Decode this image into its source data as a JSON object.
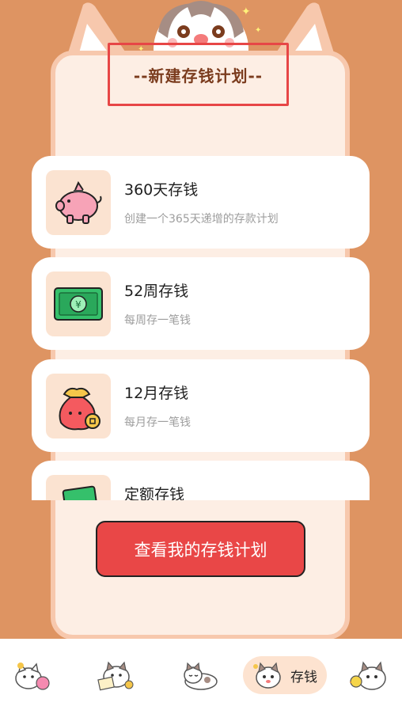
{
  "header": {
    "title": "--新建存钱计划--"
  },
  "plans": [
    {
      "name": "360天存钱",
      "description": "创建一个365天递增的存款计划",
      "icon": "piggy-bank-icon"
    },
    {
      "name": "52周存钱",
      "description": "每周存一笔钱",
      "icon": "banknote-icon"
    },
    {
      "name": "12月存钱",
      "description": "每月存一笔钱",
      "icon": "money-bag-icon"
    },
    {
      "name": "定额存钱",
      "description": "",
      "icon": "cash-stack-icon"
    }
  ],
  "actions": {
    "view_plans_label": "查看我的存钱计划"
  },
  "bottom_nav": {
    "items": [
      {
        "icon": "cat-yarn-icon"
      },
      {
        "icon": "cat-reading-icon"
      },
      {
        "icon": "cat-lying-icon"
      },
      {
        "icon": "cat-coins-icon",
        "label": "存钱",
        "active": true
      },
      {
        "icon": "cat-chick-icon"
      }
    ]
  },
  "colors": {
    "background": "#de9462",
    "panel": "#fdeee4",
    "accent": "#e94747",
    "title": "#7b3c1e"
  }
}
